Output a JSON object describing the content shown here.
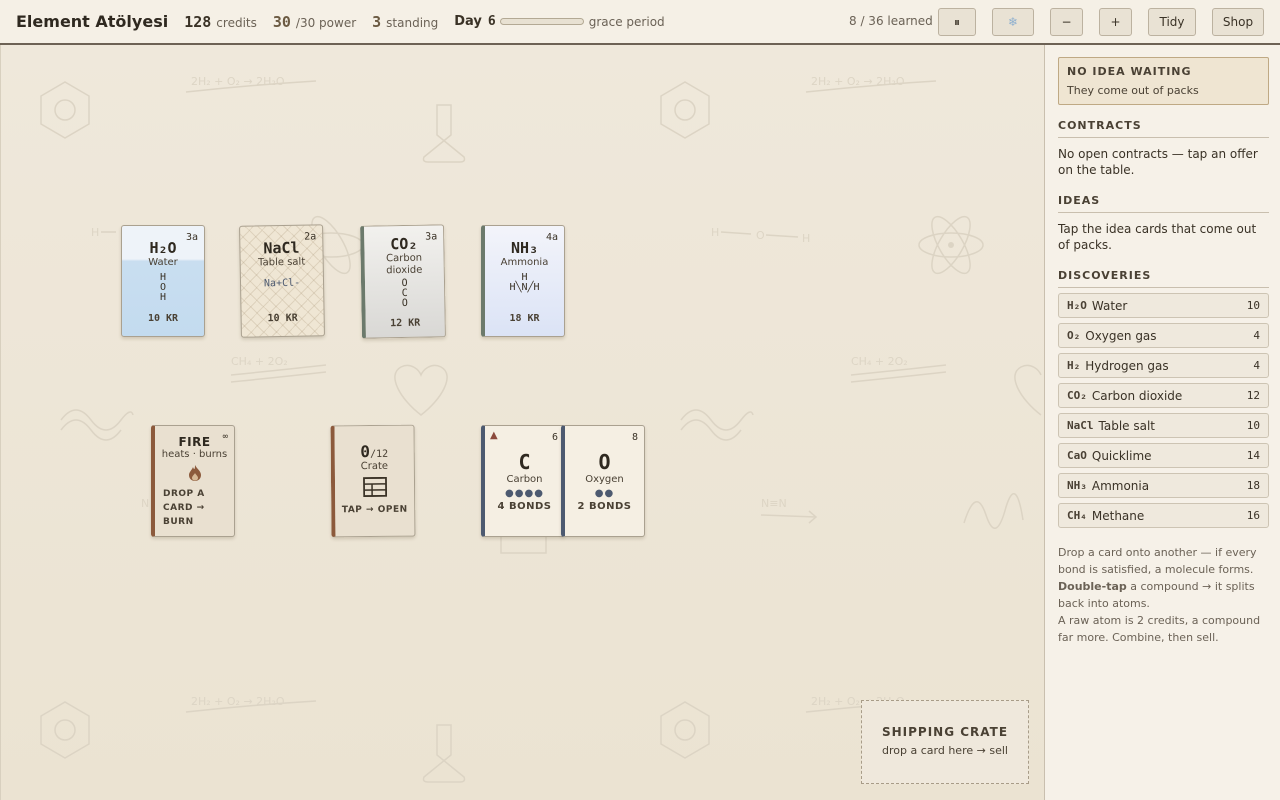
{
  "header": {
    "title": "Element Atölyesi",
    "credits_value": "128",
    "credits_label": "credits",
    "power_value": "30",
    "power_label": "/30 power",
    "standing_value": "3",
    "standing_label": "standing",
    "day_label": "Day",
    "day_value": "6",
    "day_progress": 0,
    "grace_label": "grace period",
    "learned": "8 / 36 learned",
    "buttons": {
      "pause": "⏸",
      "pause_icon": "pause-icon",
      "snow": "❄",
      "snow_icon": "snowflake-icon",
      "zoom_out": "−",
      "zoom_in": "+",
      "tidy": "Tidy",
      "shop": "Shop"
    }
  },
  "board": {
    "compounds": [
      {
        "formula": "H₂O",
        "name": "Water",
        "age": "3a",
        "price": "10 KR",
        "structure": [
          "H",
          "O",
          "H"
        ]
      },
      {
        "formula": "NaCl",
        "name": "Table salt",
        "age": "2a",
        "price": "10 KR",
        "structure": [
          "Na+Cl-"
        ]
      },
      {
        "formula": "CO₂",
        "name": "Carbon dioxide",
        "age": "3a",
        "price": "12 KR",
        "structure": [
          "O",
          "C",
          "O"
        ]
      },
      {
        "formula": "NH₃",
        "name": "Ammonia",
        "age": "4a",
        "price": "18 KR",
        "structure": [
          "H",
          "H╲N╱H"
        ]
      }
    ],
    "fire": {
      "title": "FIRE",
      "subtitle": "heats · burns",
      "infinity": "∞",
      "action": "DROP A CARD → BURN",
      "icon": "flame-icon"
    },
    "crate": {
      "count": "0",
      "capacity": "/12",
      "name": "Crate",
      "action": "TAP → OPEN",
      "icon": "crate-icon"
    },
    "atoms": [
      {
        "symbol": "C",
        "name": "Carbon",
        "number": "6",
        "bonds": "4 BONDS",
        "dots": "●●●●",
        "warning": "▲"
      },
      {
        "symbol": "O",
        "name": "Oxygen",
        "number": "8",
        "bonds": "2 BONDS",
        "dots": "●●"
      }
    ],
    "shipping": {
      "title": "SHIPPING CRATE",
      "subtitle": "drop a card here → sell"
    }
  },
  "panel": {
    "idea": {
      "title": "NO IDEA WAITING",
      "subtitle": "They come out of packs"
    },
    "contracts": {
      "title": "CONTRACTS",
      "text": "No open contracts — tap an offer on the table."
    },
    "ideas": {
      "title": "IDEAS",
      "text": "Tap the idea cards that come out of packs."
    },
    "discoveries": {
      "title": "DISCOVERIES",
      "items": [
        {
          "formula": "H₂O",
          "name": "Water",
          "value": "10"
        },
        {
          "formula": "O₂",
          "name": "Oxygen gas",
          "value": "4"
        },
        {
          "formula": "H₂",
          "name": "Hydrogen gas",
          "value": "4"
        },
        {
          "formula": "CO₂",
          "name": "Carbon dioxide",
          "value": "12"
        },
        {
          "formula": "NaCl",
          "name": "Table salt",
          "value": "10"
        },
        {
          "formula": "CaO",
          "name": "Quicklime",
          "value": "14"
        },
        {
          "formula": "NH₃",
          "name": "Ammonia",
          "value": "18"
        },
        {
          "formula": "CH₄",
          "name": "Methane",
          "value": "16"
        }
      ]
    },
    "help": {
      "line1": "Drop a card onto another — if every bond is satisfied, a molecule forms.",
      "line2_bold": "Double-tap",
      "line2_rest": " a compound → it splits back into atoms.",
      "line3": "A raw atom is 2 credits, a compound far more. Combine, then sell."
    }
  }
}
